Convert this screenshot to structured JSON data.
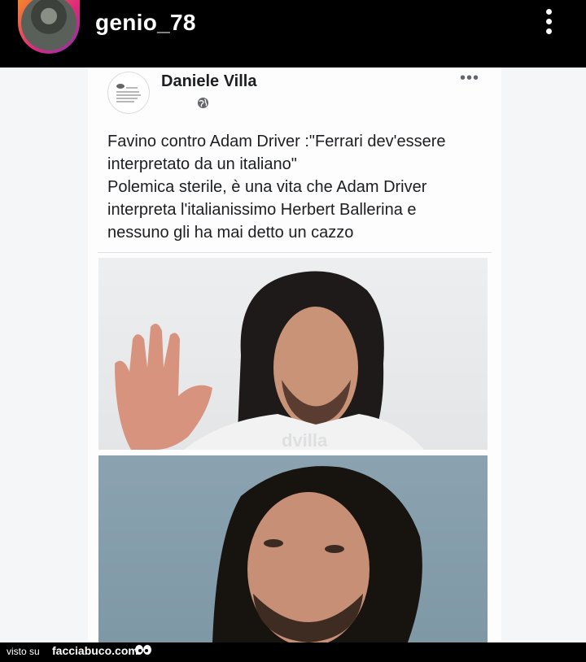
{
  "profile": {
    "username": "genio_78"
  },
  "post": {
    "author": "Daniele Villa",
    "text_lines": [
      "Favino contro Adam Driver :\"Ferrari dev'essere",
      "interpretato da un italiano\"",
      "Polemica sterile, è una vita che Adam Driver",
      "interpreta l'italianissimo Herbert Ballerina e",
      "nessuno gli ha mai detto un cazzo"
    ],
    "options_label": "•••"
  },
  "footer": {
    "seen_on": "visto su",
    "brand": "facciabuco.com"
  },
  "icons": {
    "menu": "more-vert-icon",
    "privacy": "globe-icon",
    "logo": "eyes-icon"
  },
  "colors": {
    "topbar": "#000000",
    "avatar_ring_start": "#f58529",
    "avatar_ring_end": "#8134af",
    "card_text": "#1c1e21"
  }
}
